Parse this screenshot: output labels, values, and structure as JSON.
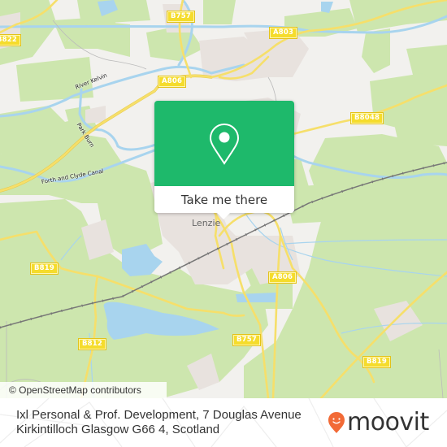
{
  "map": {
    "attribution": "© OpenStreetMap contributors",
    "town_label": "Lenzie",
    "road_labels": [
      {
        "id": "b757-north",
        "text": "B757"
      },
      {
        "id": "b822",
        "text": "B822"
      },
      {
        "id": "a803",
        "text": "A803"
      },
      {
        "id": "a806-north",
        "text": "A806"
      },
      {
        "id": "b8048",
        "text": "B8048"
      },
      {
        "id": "b819-west",
        "text": "B819"
      },
      {
        "id": "a806-south",
        "text": "A806"
      },
      {
        "id": "b812",
        "text": "B812"
      },
      {
        "id": "b757-south",
        "text": "B757"
      },
      {
        "id": "b819-east",
        "text": "B819"
      }
    ],
    "water_labels": [
      {
        "id": "river-kelvin",
        "text": "River Kelvin"
      },
      {
        "id": "park-burn",
        "text": "Park Burn"
      },
      {
        "id": "forth-clyde-canal",
        "text": "Forth and Clyde Canal"
      }
    ],
    "colors": {
      "land": "#f2f1ee",
      "green": "#cde6ae",
      "water": "#a8d4ee",
      "road": "#f6df6a",
      "urban": "#e8e2de"
    }
  },
  "popup": {
    "button_label": "Take me there",
    "icon": "map-pin-icon",
    "color": "#1eb96b"
  },
  "footer": {
    "address_line1": "Ixl Personal & Prof. Development, 7 Douglas Avenue",
    "address_line2": "Kirkintilloch Glasgow G66 4, Scotland",
    "brand": "moovit",
    "brand_color": "#f26a36"
  }
}
